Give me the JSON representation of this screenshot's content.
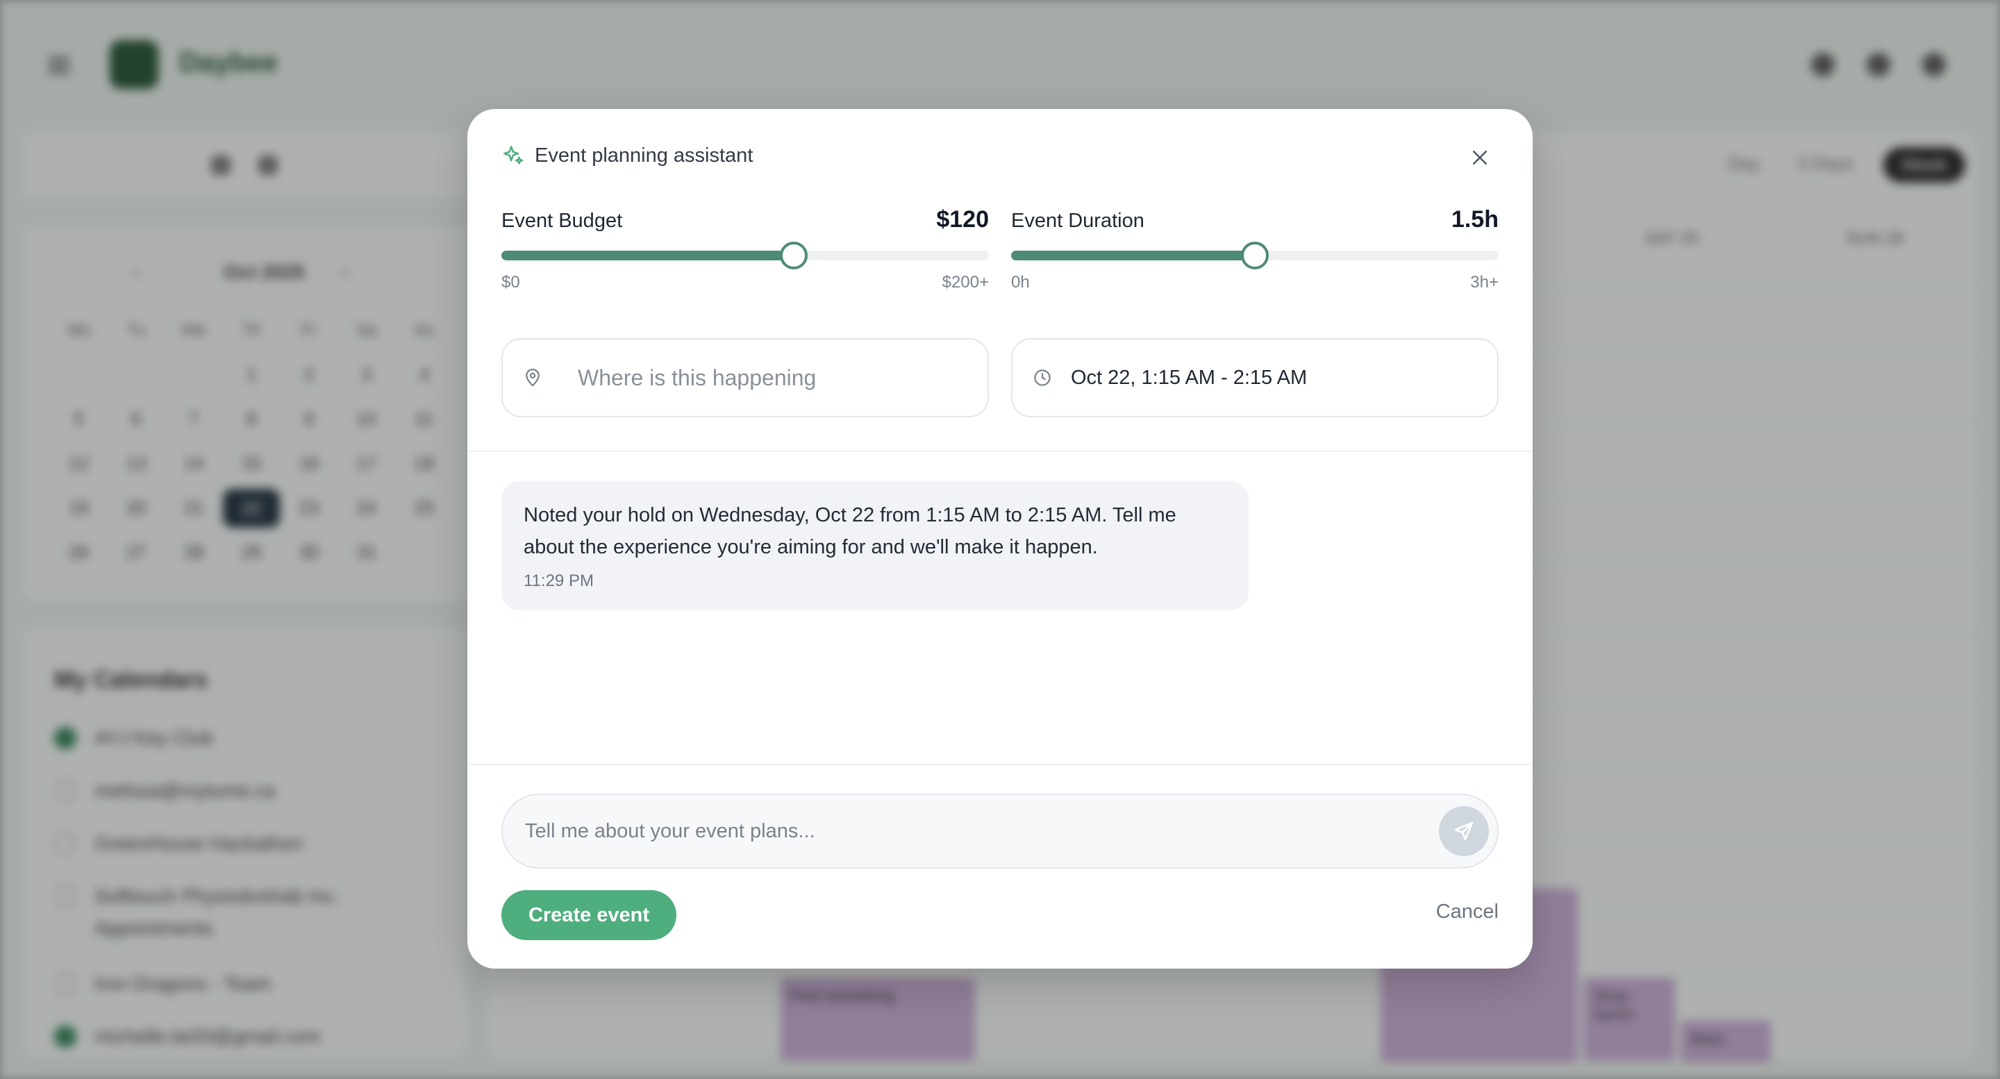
{
  "background": {
    "brand": "Daybee",
    "mini_calendar": {
      "month": "Oct 2025",
      "weekdays": [
        "Mo",
        "Tu",
        "We",
        "Th",
        "Fr",
        "Sa",
        "Su"
      ],
      "days": [
        "",
        "",
        "",
        "1",
        "2",
        "3",
        "4",
        "5",
        "6",
        "7",
        "8",
        "9",
        "10",
        "11",
        "12",
        "13",
        "14",
        "15",
        "16",
        "17",
        "18",
        "19",
        "20",
        "21",
        "22",
        "23",
        "24",
        "25",
        "26",
        "27",
        "28",
        "29",
        "30",
        "31"
      ],
      "selected_day": "22"
    },
    "my_calendars": {
      "title": "My Calendars",
      "items": [
        "AYJ Key Club",
        "melissa@mytume.ca",
        "GreenHouse Hackathon",
        "Softtouch Physio&rehab Inc. Appointments",
        "Iron Dragons - Team",
        "michelle.lai20@gmail.com"
      ]
    },
    "views": [
      "Day",
      "3 Days",
      "Week"
    ],
    "active_view": "Week",
    "day_headers": [
      "SAT 25",
      "SUN 26"
    ],
    "events": [
      "Find something",
      "Shop Spree",
      "Meet"
    ]
  },
  "modal": {
    "title": "Event planning assistant",
    "budget": {
      "label": "Event Budget",
      "value": "$120",
      "min": "$0",
      "max": "$200+",
      "fraction": 0.6
    },
    "duration": {
      "label": "Event Duration",
      "value": "1.5h",
      "min": "0h",
      "max": "3h+",
      "fraction": 0.5
    },
    "location_placeholder": "Where is this happening",
    "time_range": "Oct 22, 1:15 AM - 2:15 AM",
    "message": {
      "text": "Noted your hold on Wednesday, Oct 22 from 1:15 AM to 2:15 AM. Tell me about the experience you're aiming for and we'll make it happen.",
      "time": "11:29 PM"
    },
    "chat_placeholder": "Tell me about your event plans...",
    "create_label": "Create event",
    "cancel_label": "Cancel"
  },
  "colors": {
    "accent_green": "#4fae7d",
    "slider_green": "#4e8b74",
    "brand_dark": "#1f4d2e"
  }
}
